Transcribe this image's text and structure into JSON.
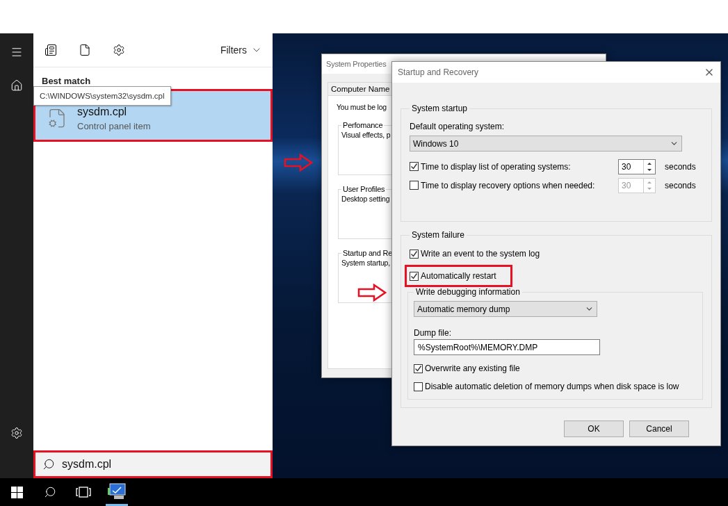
{
  "start_menu": {
    "filters_label": "Filters",
    "section_heading": "Best match",
    "results": [
      {
        "title": "sysdm.cpl",
        "subtitle": "Control panel item",
        "selected": true,
        "annotated": true
      }
    ],
    "tooltip": "C:\\WINDOWS\\system32\\sysdm.cpl",
    "search": {
      "value": "sysdm.cpl",
      "annotated": true
    }
  },
  "system_properties": {
    "title": "System Properties",
    "tabs": [
      {
        "label": "Computer Name",
        "selected": false
      }
    ],
    "intro": "You must be log",
    "groups": [
      {
        "title": "Perfomance",
        "text": "Visual effects, p"
      },
      {
        "title": "User Profiles",
        "text": "Desktop setting"
      },
      {
        "title": "Startup and Re",
        "text": "System startup,"
      }
    ]
  },
  "startup_recovery": {
    "title": "Startup and Recovery",
    "system_startup": {
      "title": "System startup",
      "os_label": "Default operating system:",
      "os_value": "Windows 10",
      "options": [
        {
          "label": "Time to display list of operating systems:",
          "checked": true,
          "value": "30",
          "unit": "seconds"
        },
        {
          "label": "Time to display recovery options when needed:",
          "checked": false,
          "value": "30",
          "unit": "seconds"
        }
      ]
    },
    "system_failure": {
      "title": "System failure",
      "options": [
        {
          "label": "Write an event to the system log",
          "checked": true
        },
        {
          "label": "Automatically restart",
          "checked": true,
          "annotated": true
        }
      ],
      "debugging": {
        "title": "Write debugging information",
        "dump_type": "Automatic memory dump",
        "dump_file_label": "Dump file:",
        "dump_file": "%SystemRoot%\\MEMORY.DMP",
        "options": [
          {
            "label": "Overwrite any existing file",
            "checked": true
          },
          {
            "label": "Disable automatic deletion of memory dumps when disk space is low",
            "checked": false
          }
        ]
      }
    },
    "buttons": [
      {
        "label": "OK"
      },
      {
        "label": "Cancel"
      }
    ]
  }
}
